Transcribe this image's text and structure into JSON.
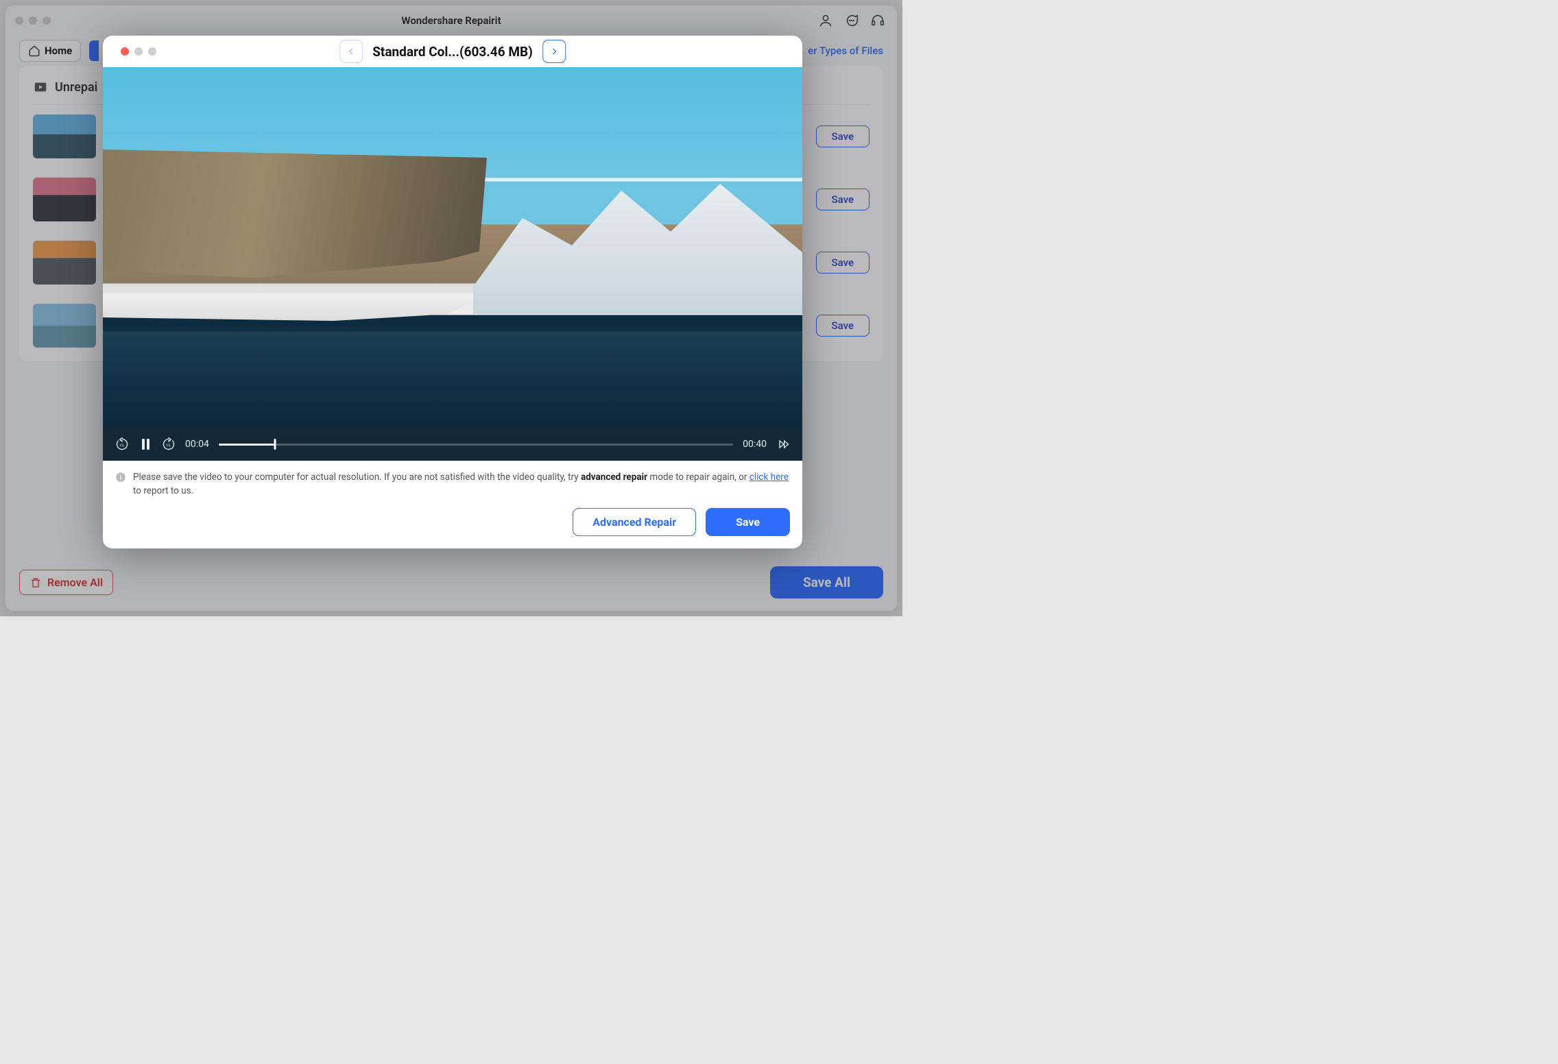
{
  "app": {
    "title": "Wondershare Repairit",
    "home_label": "Home",
    "other_types_label": "er Types of Files",
    "section_title": "Unrepai",
    "save_chip": "Save",
    "remove_all": "Remove All",
    "save_all": "Save All"
  },
  "modal": {
    "title": "Standard Col...(603.46 MB)",
    "current_time": "00:04",
    "total_time": "00:40",
    "info_pre": "Please save the video to your computer for actual resolution. If you are not satisfied with the video quality, try ",
    "info_bold": "advanced repair",
    "info_mid": " mode to repair again, or ",
    "info_link": "click here",
    "info_post": " to report to us.",
    "advanced_repair": "Advanced Repair",
    "save": "Save"
  }
}
